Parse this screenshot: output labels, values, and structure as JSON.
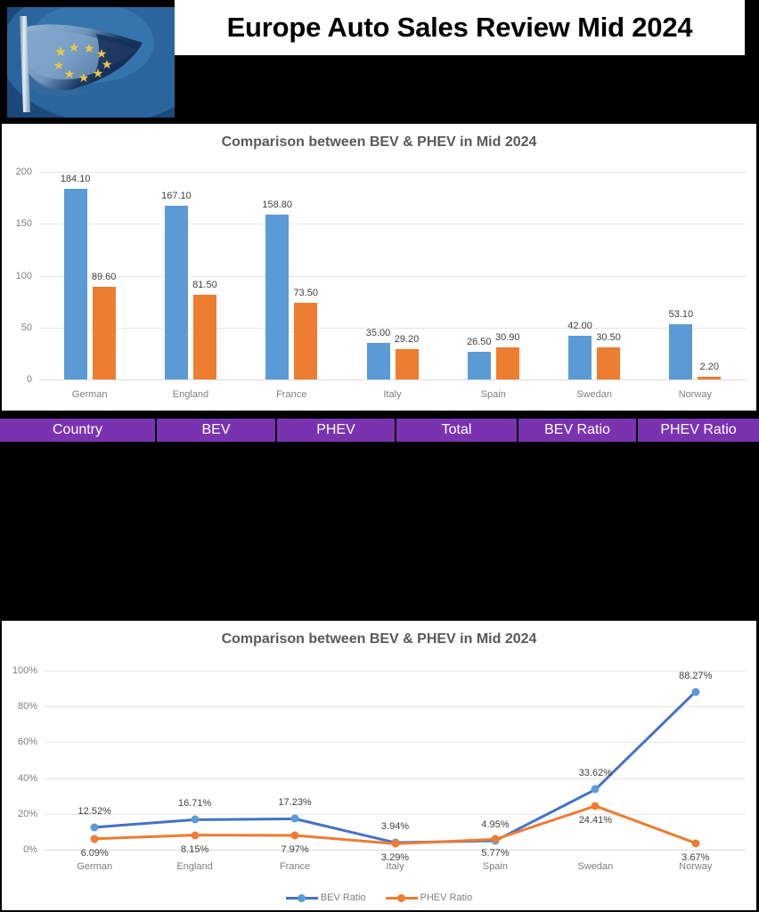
{
  "header": {
    "title": "Europe Auto Sales Review Mid 2024",
    "flag_icon": "eu-flag-image"
  },
  "table": {
    "columns": [
      "Country",
      "BEV",
      "PHEV",
      "Total",
      "BEV Ratio",
      "PHEV Ratio"
    ],
    "header_color": "#7A33B0",
    "header_text_color": "#FFFFFF"
  },
  "colors": {
    "bev_bar": "#5B9BD5",
    "phev_bar": "#ED7D31",
    "bev_line": "#4472C4",
    "phev_line": "#ED7D31",
    "title_text": "#595959",
    "tick_text": "#7F7F7F"
  },
  "chart_data": [
    {
      "type": "bar",
      "title": "Comparison between BEV & PHEV in Mid 2024",
      "xlabel": "",
      "ylabel": "",
      "ylim": [
        0,
        200
      ],
      "yticks": [
        "0",
        "50",
        "100",
        "150",
        "200"
      ],
      "grid": true,
      "legend": "none",
      "categories": [
        "German",
        "England",
        "France",
        "Italy",
        "Spain",
        "Swedan",
        "Norway"
      ],
      "series": [
        {
          "name": "BEV",
          "color": "#5B9BD5",
          "values": [
            184.1,
            167.1,
            158.8,
            35.0,
            26.5,
            42.0,
            53.1
          ],
          "labels": [
            "184.10",
            "167.10",
            "158.80",
            "35.00",
            "26.50",
            "42.00",
            "53.10"
          ]
        },
        {
          "name": "PHEV",
          "color": "#ED7D31",
          "values": [
            89.6,
            81.5,
            73.5,
            29.2,
            30.9,
            30.5,
            2.2
          ],
          "labels": [
            "89.60",
            "81.50",
            "73.50",
            "29.20",
            "30.90",
            "30.50",
            "2.20"
          ]
        }
      ]
    },
    {
      "type": "line",
      "title": "Comparison between BEV & PHEV in Mid 2024",
      "xlabel": "",
      "ylabel": "",
      "ylim": [
        0,
        100
      ],
      "yticks": [
        "0%",
        "20%",
        "40%",
        "60%",
        "80%",
        "100%"
      ],
      "grid": true,
      "legend": "bottom",
      "categories": [
        "German",
        "England",
        "France",
        "Italy",
        "Spain",
        "Swedan",
        "Norway"
      ],
      "series": [
        {
          "name": "BEV Ratio",
          "color": "#4472C4",
          "values": [
            12.52,
            16.71,
            17.23,
            3.94,
            4.95,
            33.62,
            88.27
          ],
          "labels": [
            "12.52%",
            "16.71%",
            "17.23%",
            "3.94%",
            "4.95%",
            "33.62%",
            "88.27%"
          ]
        },
        {
          "name": "PHEV Ratio",
          "color": "#ED7D31",
          "values": [
            6.09,
            8.15,
            7.97,
            3.29,
            5.77,
            24.41,
            3.67
          ],
          "labels": [
            "6.09%",
            "8.15%",
            "7.97%",
            "3.29%",
            "5.77%",
            "24.41%",
            "3.67%"
          ]
        }
      ]
    }
  ]
}
